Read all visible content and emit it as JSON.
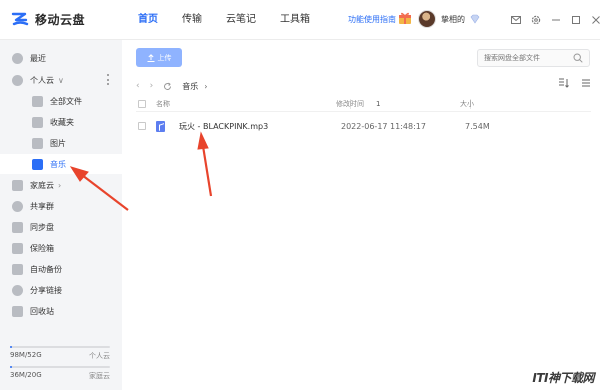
{
  "app": {
    "title": "移动云盘"
  },
  "nav": {
    "items": [
      "首页",
      "传输",
      "云笔记",
      "工具箱"
    ],
    "active": "首页"
  },
  "header": {
    "guide_link": "功能使用指南",
    "username": "挚相的"
  },
  "sidebar": {
    "recent": "最近",
    "personal_cloud": "个人云",
    "personal_items": [
      "全部文件",
      "收藏夹",
      "图片",
      "音乐"
    ],
    "active_item": "音乐",
    "family_cloud": "家庭云",
    "others": [
      "共享群",
      "同步盘",
      "保险箱",
      "自动备份",
      "分享链接",
      "回收站"
    ]
  },
  "storage": [
    {
      "used": "98M/52G",
      "label": "个人云",
      "fraction": 0.002
    },
    {
      "used": "36M/20G",
      "label": "家庭云",
      "fraction": 0.002
    }
  ],
  "toolbar": {
    "upload_label": "上传"
  },
  "search": {
    "placeholder": "搜索网盘全部文件"
  },
  "breadcrumb": {
    "current": "音乐"
  },
  "table": {
    "headers": {
      "name": "名称",
      "time": "修改时间",
      "sort": "1",
      "size": "大小"
    },
    "rows": [
      {
        "name": "玩火 - BLACKPINK.mp3",
        "time": "2022-06-17 11:48:17",
        "size": "7.54M"
      }
    ]
  },
  "colors": {
    "accent": "#2b6ef6",
    "arrow": "#e8442c",
    "upload_btn": "#8fb3ff"
  },
  "watermark": "ITI神下载网"
}
